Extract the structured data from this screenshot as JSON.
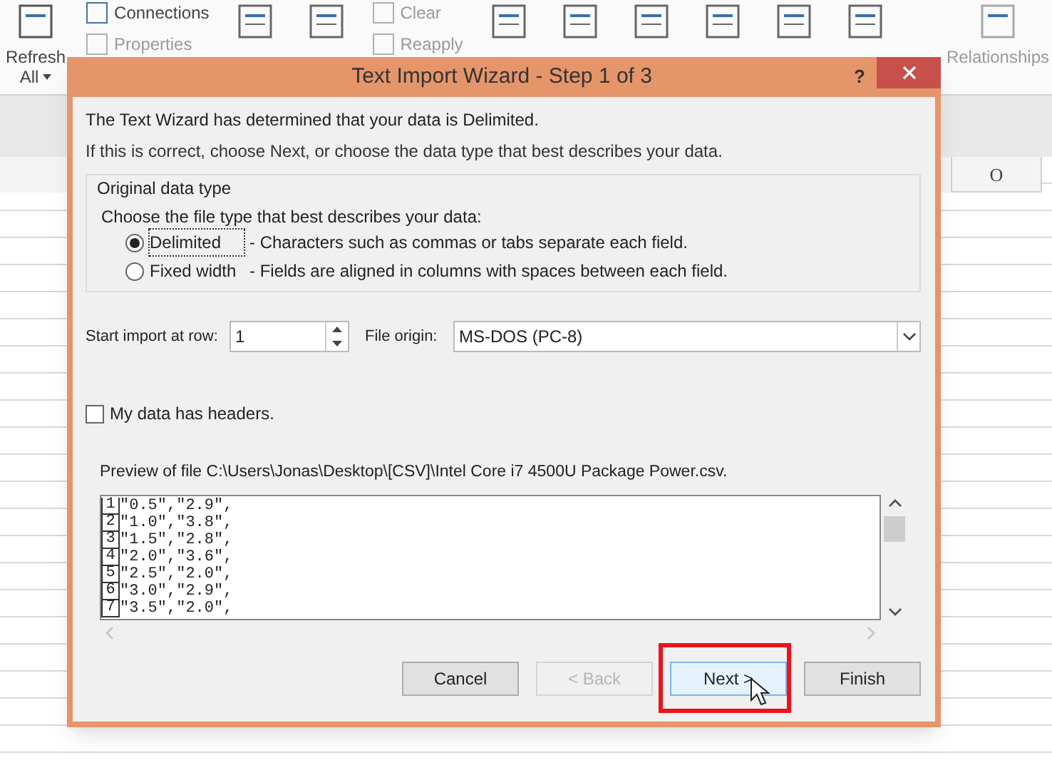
{
  "ribbon": [
    {
      "kind": "large",
      "label": "Refresh",
      "sub": "All",
      "disabled": false
    },
    {
      "kind": "stack",
      "items": [
        {
          "label": "Connections",
          "disabled": false
        },
        {
          "label": "Properties",
          "disabled": true
        }
      ]
    },
    {
      "kind": "icon"
    },
    {
      "kind": "icon"
    },
    {
      "kind": "stack",
      "items": [
        {
          "label": "Clear",
          "disabled": true
        },
        {
          "label": "Reapply",
          "disabled": true
        }
      ]
    },
    {
      "kind": "icon"
    },
    {
      "kind": "icon"
    },
    {
      "kind": "icon"
    },
    {
      "kind": "icon"
    },
    {
      "kind": "icon"
    },
    {
      "kind": "icon"
    },
    {
      "kind": "large",
      "label": "Relationships",
      "disabled": true
    }
  ],
  "sheet": {
    "columns": [
      "O"
    ]
  },
  "dialog": {
    "title": "Text Import Wizard - Step 1 of 3",
    "help": "?",
    "intro": "The Text Wizard has determined that your data is Delimited.",
    "hint": "If this is correct, choose Next, or choose the data type that best describes your data.",
    "group": {
      "title": "Original data type",
      "prompt": "Choose the file type that best describes your data:",
      "options": [
        {
          "label": "Delimited",
          "description": "- Characters such as commas or tabs separate each field.",
          "selected": true
        },
        {
          "label": "Fixed width",
          "description": "- Fields are aligned in columns with spaces between each field.",
          "selected": false
        }
      ]
    },
    "start_row": {
      "label": "Start import at row:",
      "value": "1"
    },
    "file_origin": {
      "label": "File origin:",
      "value": "MS-DOS (PC-8)"
    },
    "headers": {
      "label": "My data has headers.",
      "checked": false
    },
    "preview": {
      "label": "Preview of file C:\\Users\\Jonas\\Desktop\\[CSV]\\Intel Core i7 4500U Package Power.csv.",
      "lines": [
        {
          "number": "1",
          "text": "\"0.5\",\"2.9\","
        },
        {
          "number": "2",
          "text": "\"1.0\",\"3.8\","
        },
        {
          "number": "3",
          "text": "\"1.5\",\"2.8\","
        },
        {
          "number": "4",
          "text": "\"2.0\",\"3.6\","
        },
        {
          "number": "5",
          "text": "\"2.5\",\"2.0\","
        },
        {
          "number": "6",
          "text": "\"3.0\",\"2.9\","
        },
        {
          "number": "7",
          "text": "\"3.5\",\"2.0\","
        }
      ]
    },
    "buttons": [
      {
        "label": "Cancel",
        "disabled": false,
        "highlighted": false
      },
      {
        "label": "< Back",
        "disabled": true,
        "highlighted": false
      },
      {
        "label": "Next >",
        "disabled": false,
        "highlighted": true
      },
      {
        "label": "Finish",
        "disabled": false,
        "highlighted": false
      }
    ]
  }
}
